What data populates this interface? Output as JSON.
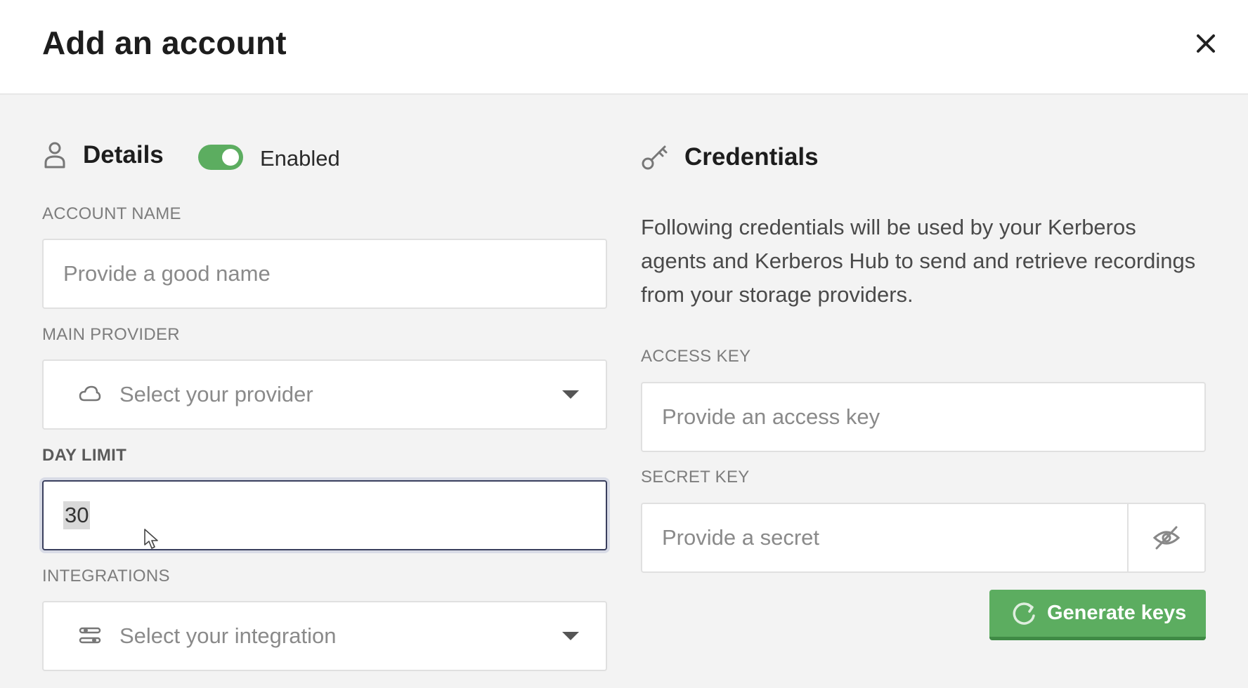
{
  "dialog": {
    "title": "Add an account"
  },
  "details": {
    "section_title": "Details",
    "toggle_label": "Enabled",
    "toggle_on": true,
    "account_name": {
      "label": "ACCOUNT NAME",
      "placeholder": "Provide a good name",
      "value": ""
    },
    "main_provider": {
      "label": "MAIN PROVIDER",
      "placeholder": "Select your provider",
      "icon": "cloud-icon"
    },
    "day_limit": {
      "label": "DAY LIMIT",
      "value": "30"
    },
    "integrations": {
      "label": "INTEGRATIONS",
      "placeholder": "Select your integration",
      "icon": "integration-icon"
    }
  },
  "credentials": {
    "section_title": "Credentials",
    "description": "Following credentials will be used by your Kerberos agents and Kerberos Hub to send and retrieve recordings from your storage providers.",
    "access_key": {
      "label": "ACCESS KEY",
      "placeholder": "Provide an access key",
      "value": ""
    },
    "secret_key": {
      "label": "SECRET KEY",
      "placeholder": "Provide a secret",
      "value": "",
      "icon": "eye-slash-icon"
    },
    "generate_button": "Generate keys"
  },
  "colors": {
    "accent_green": "#5cad60",
    "focus_border": "#3a3f5e"
  }
}
